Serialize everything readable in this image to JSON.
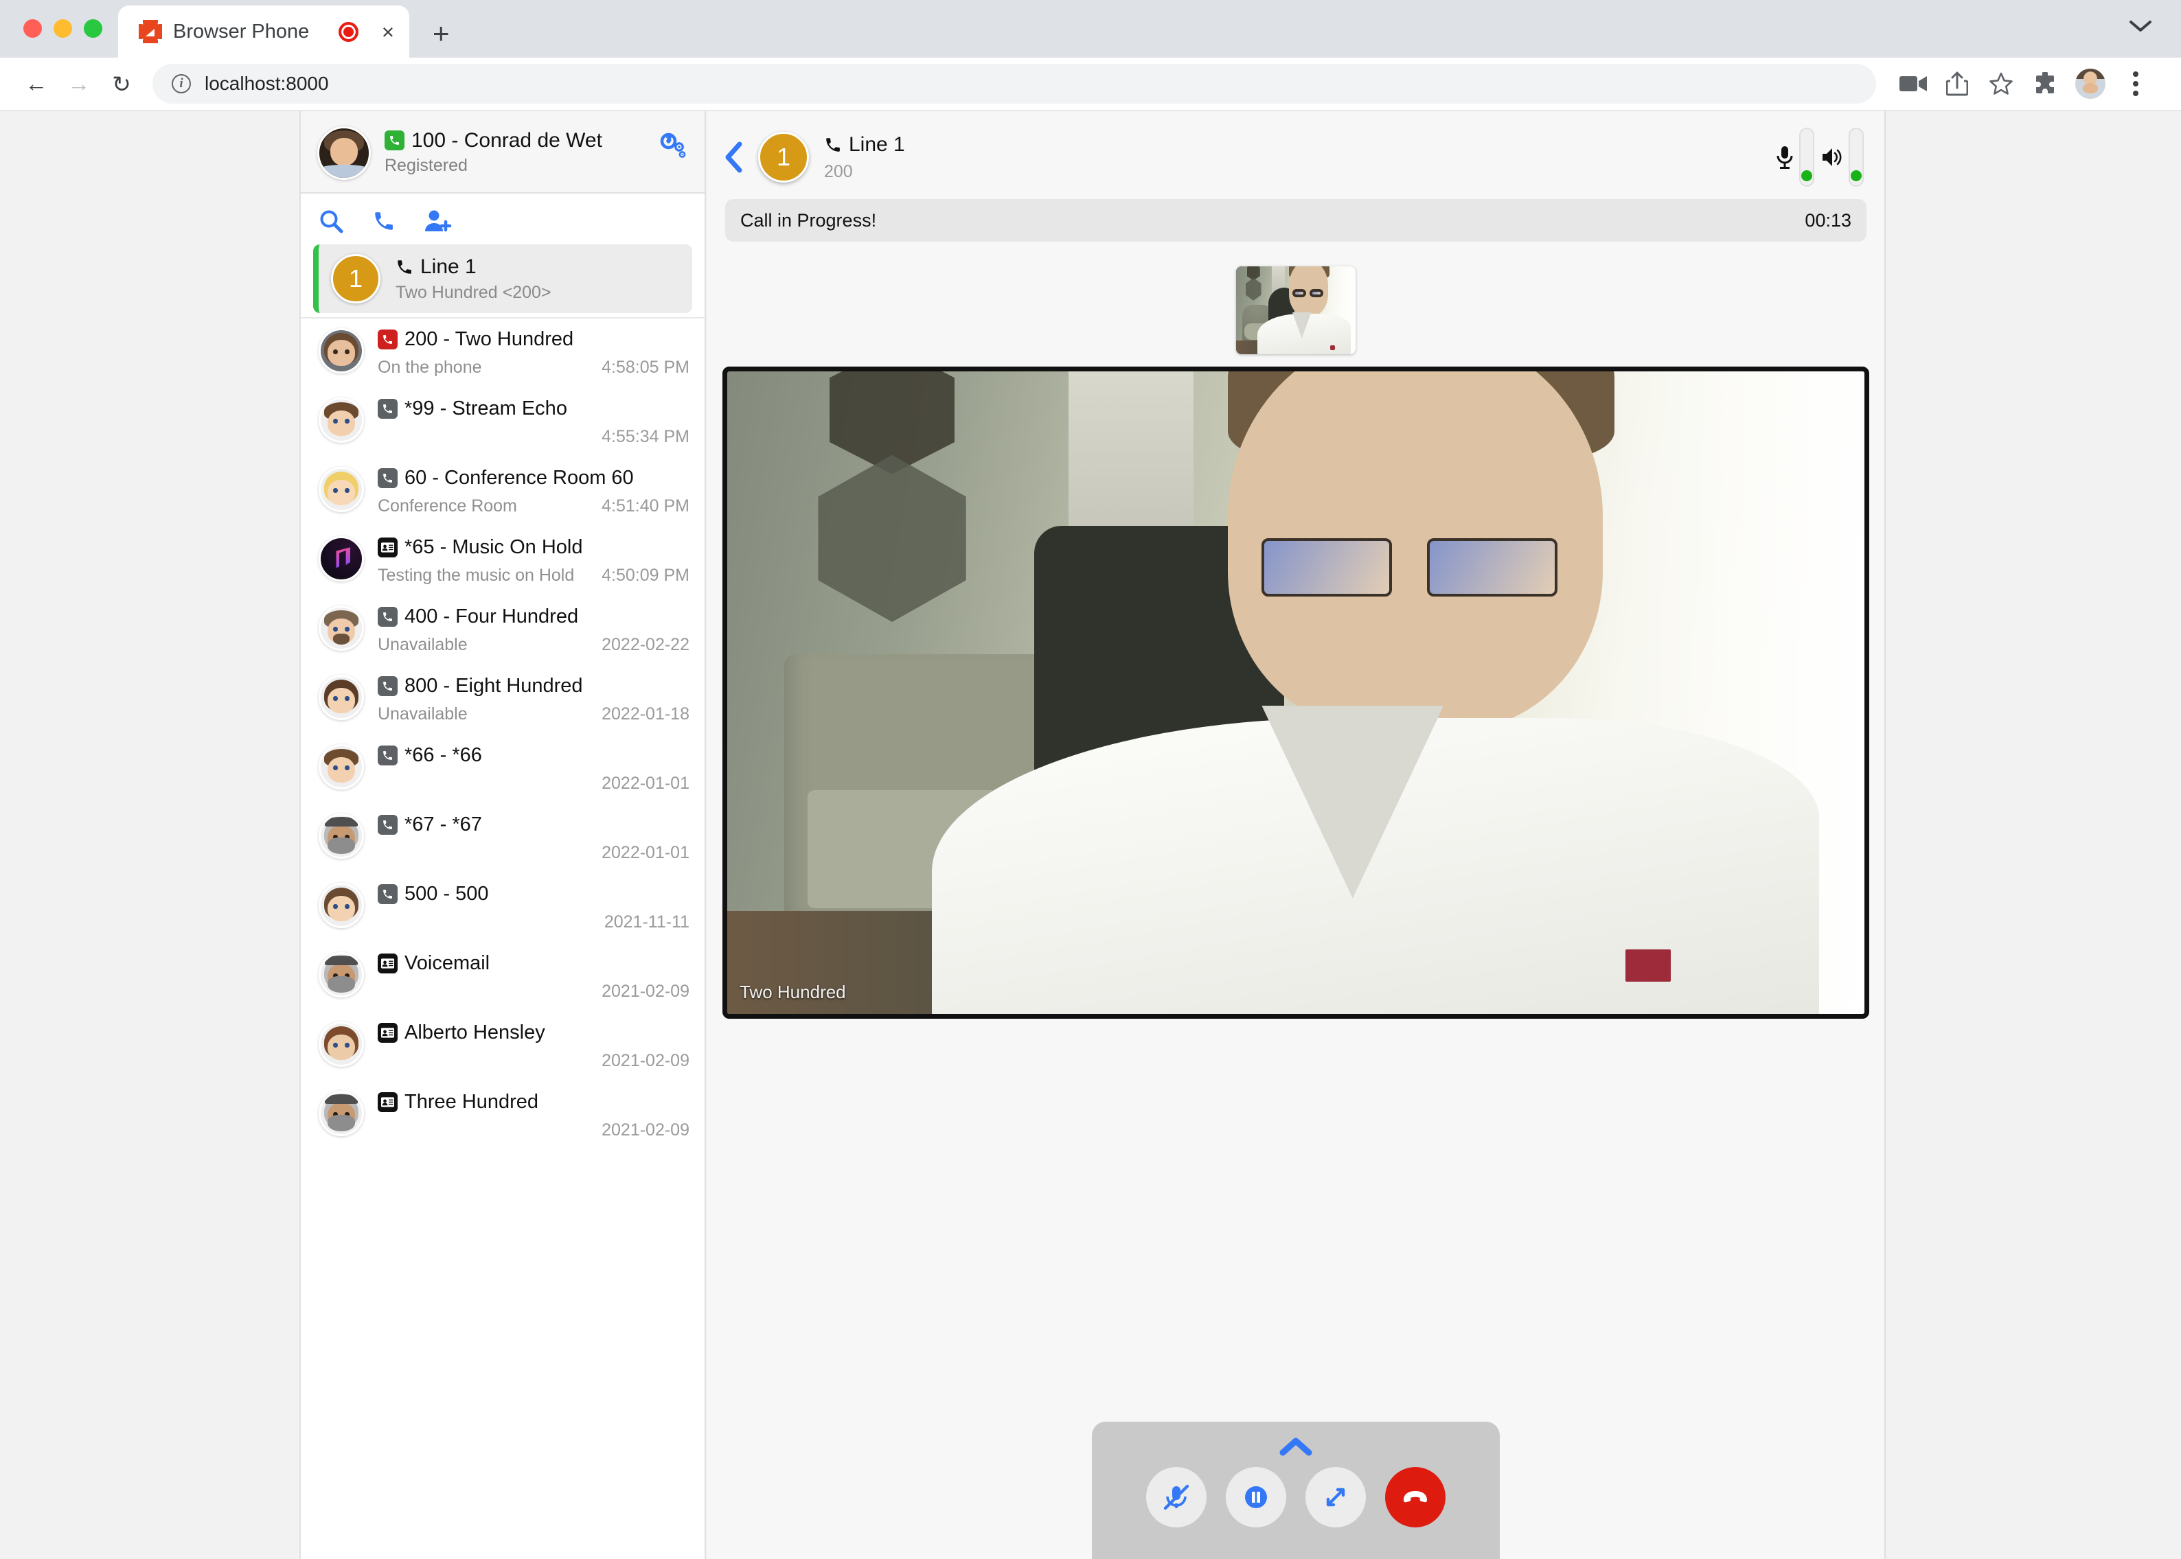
{
  "browser": {
    "tab": {
      "title": "Browser Phone",
      "favicon": "chip-icon",
      "recording_indicator": "record-icon",
      "close": "×"
    },
    "newtab_label": "+",
    "tabstrip_chevron": "chevron-down-icon",
    "nav": {
      "back": "←",
      "forward": "→",
      "reload": "↻"
    },
    "omnibox": {
      "scheme": "",
      "url": "localhost:8000",
      "info": "i"
    },
    "toolbar_icons": [
      "video-camera-icon",
      "share-icon",
      "star-icon",
      "extensions-icon",
      "profile-avatar",
      "kebab-menu-icon"
    ]
  },
  "sidebar": {
    "profile": {
      "name": "100 - Conrad de Wet",
      "status": "Registered",
      "status_badge": "phone-icon",
      "settings_label": "gears-icon"
    },
    "quick_actions": [
      {
        "name": "search-icon",
        "glyph": "🔍"
      },
      {
        "name": "dial-icon",
        "glyph": "📞"
      },
      {
        "name": "add-contact-icon",
        "glyph": "👤"
      }
    ],
    "line": {
      "number": "1",
      "title": "Line 1",
      "title_icon": "phone-handset-icon",
      "subtitle": "Two Hundred <200>"
    },
    "contacts": [
      {
        "name": "200 - Two Hundred",
        "status": "On the phone",
        "time": "4:58:05 PM",
        "badge": "phone-icon",
        "badge_color": "red",
        "avatar": "photo-woman-brown-hair"
      },
      {
        "name": "*99 - Stream Echo",
        "status": "",
        "time": "4:55:34 PM",
        "badge": "phone-icon",
        "badge_color": "grey",
        "avatar": "memoji-man-brown-hair"
      },
      {
        "name": "60 - Conference Room 60",
        "status": "Conference Room",
        "time": "4:51:40 PM",
        "badge": "phone-icon",
        "badge_color": "grey",
        "avatar": "memoji-woman-blonde"
      },
      {
        "name": "*65 - Music On Hold",
        "status": "Testing the music on Hold",
        "time": "4:50:09 PM",
        "badge": "contact-card-icon",
        "badge_color": "black",
        "avatar": "music-note-logo"
      },
      {
        "name": "400 - Four Hundred",
        "status": "Unavailable",
        "time": "2022-02-22",
        "badge": "phone-icon",
        "badge_color": "grey",
        "avatar": "memoji-man-beard"
      },
      {
        "name": "800 - Eight Hundred",
        "status": "Unavailable",
        "time": "2022-01-18",
        "badge": "phone-icon",
        "badge_color": "grey",
        "avatar": "memoji-woman-long-brown"
      },
      {
        "name": "*66 - *66",
        "status": "",
        "time": "2022-01-01",
        "badge": "phone-icon",
        "badge_color": "grey",
        "avatar": "memoji-boy-brown-hair"
      },
      {
        "name": "*67 - *67",
        "status": "",
        "time": "2022-01-01",
        "badge": "phone-icon",
        "badge_color": "grey",
        "avatar": "memoji-man-keffiyeh"
      },
      {
        "name": "500 - 500",
        "status": "",
        "time": "2021-11-11",
        "badge": "phone-icon",
        "badge_color": "grey",
        "avatar": "memoji-woman-brown-hair"
      },
      {
        "name": "Voicemail",
        "status": "",
        "time": "2021-02-09",
        "badge": "contact-card-icon",
        "badge_color": "black",
        "avatar": "memoji-man-keffiyeh"
      },
      {
        "name": "Alberto Hensley",
        "status": "",
        "time": "2021-02-09",
        "badge": "contact-card-icon",
        "badge_color": "black",
        "avatar": "memoji-woman-auburn"
      },
      {
        "name": "Three Hundred",
        "status": "",
        "time": "2021-02-09",
        "badge": "contact-card-icon",
        "badge_color": "black",
        "avatar": "memoji-man-keffiyeh"
      }
    ]
  },
  "call": {
    "back_label": "‹",
    "line_number": "1",
    "title": "Line 1",
    "title_icon": "phone-handset-icon",
    "remote_number": "200",
    "mic_icon": "microphone-icon",
    "speaker_icon": "speaker-icon",
    "status_text": "Call in Progress!",
    "timer": "00:13",
    "remote_video_label": "Two Hundred",
    "self_video_label": "self-view",
    "controls": {
      "expand_label": "chevron-up-icon",
      "buttons": [
        {
          "name": "mute-button",
          "icon": "mic-muted-icon"
        },
        {
          "name": "hold-button",
          "icon": "pause-icon"
        },
        {
          "name": "fullscreen-button",
          "icon": "expand-arrows-icon"
        },
        {
          "name": "hangup-button",
          "icon": "hangup-phone-icon"
        }
      ]
    }
  },
  "colors": {
    "accent_blue": "#3478f6",
    "line_amber": "#d79a16",
    "active_green": "#33c14a",
    "hangup_red": "#de1b0f",
    "status_green": "#17b317",
    "badge_red": "#cf2020",
    "badge_grey": "#5d6065"
  }
}
